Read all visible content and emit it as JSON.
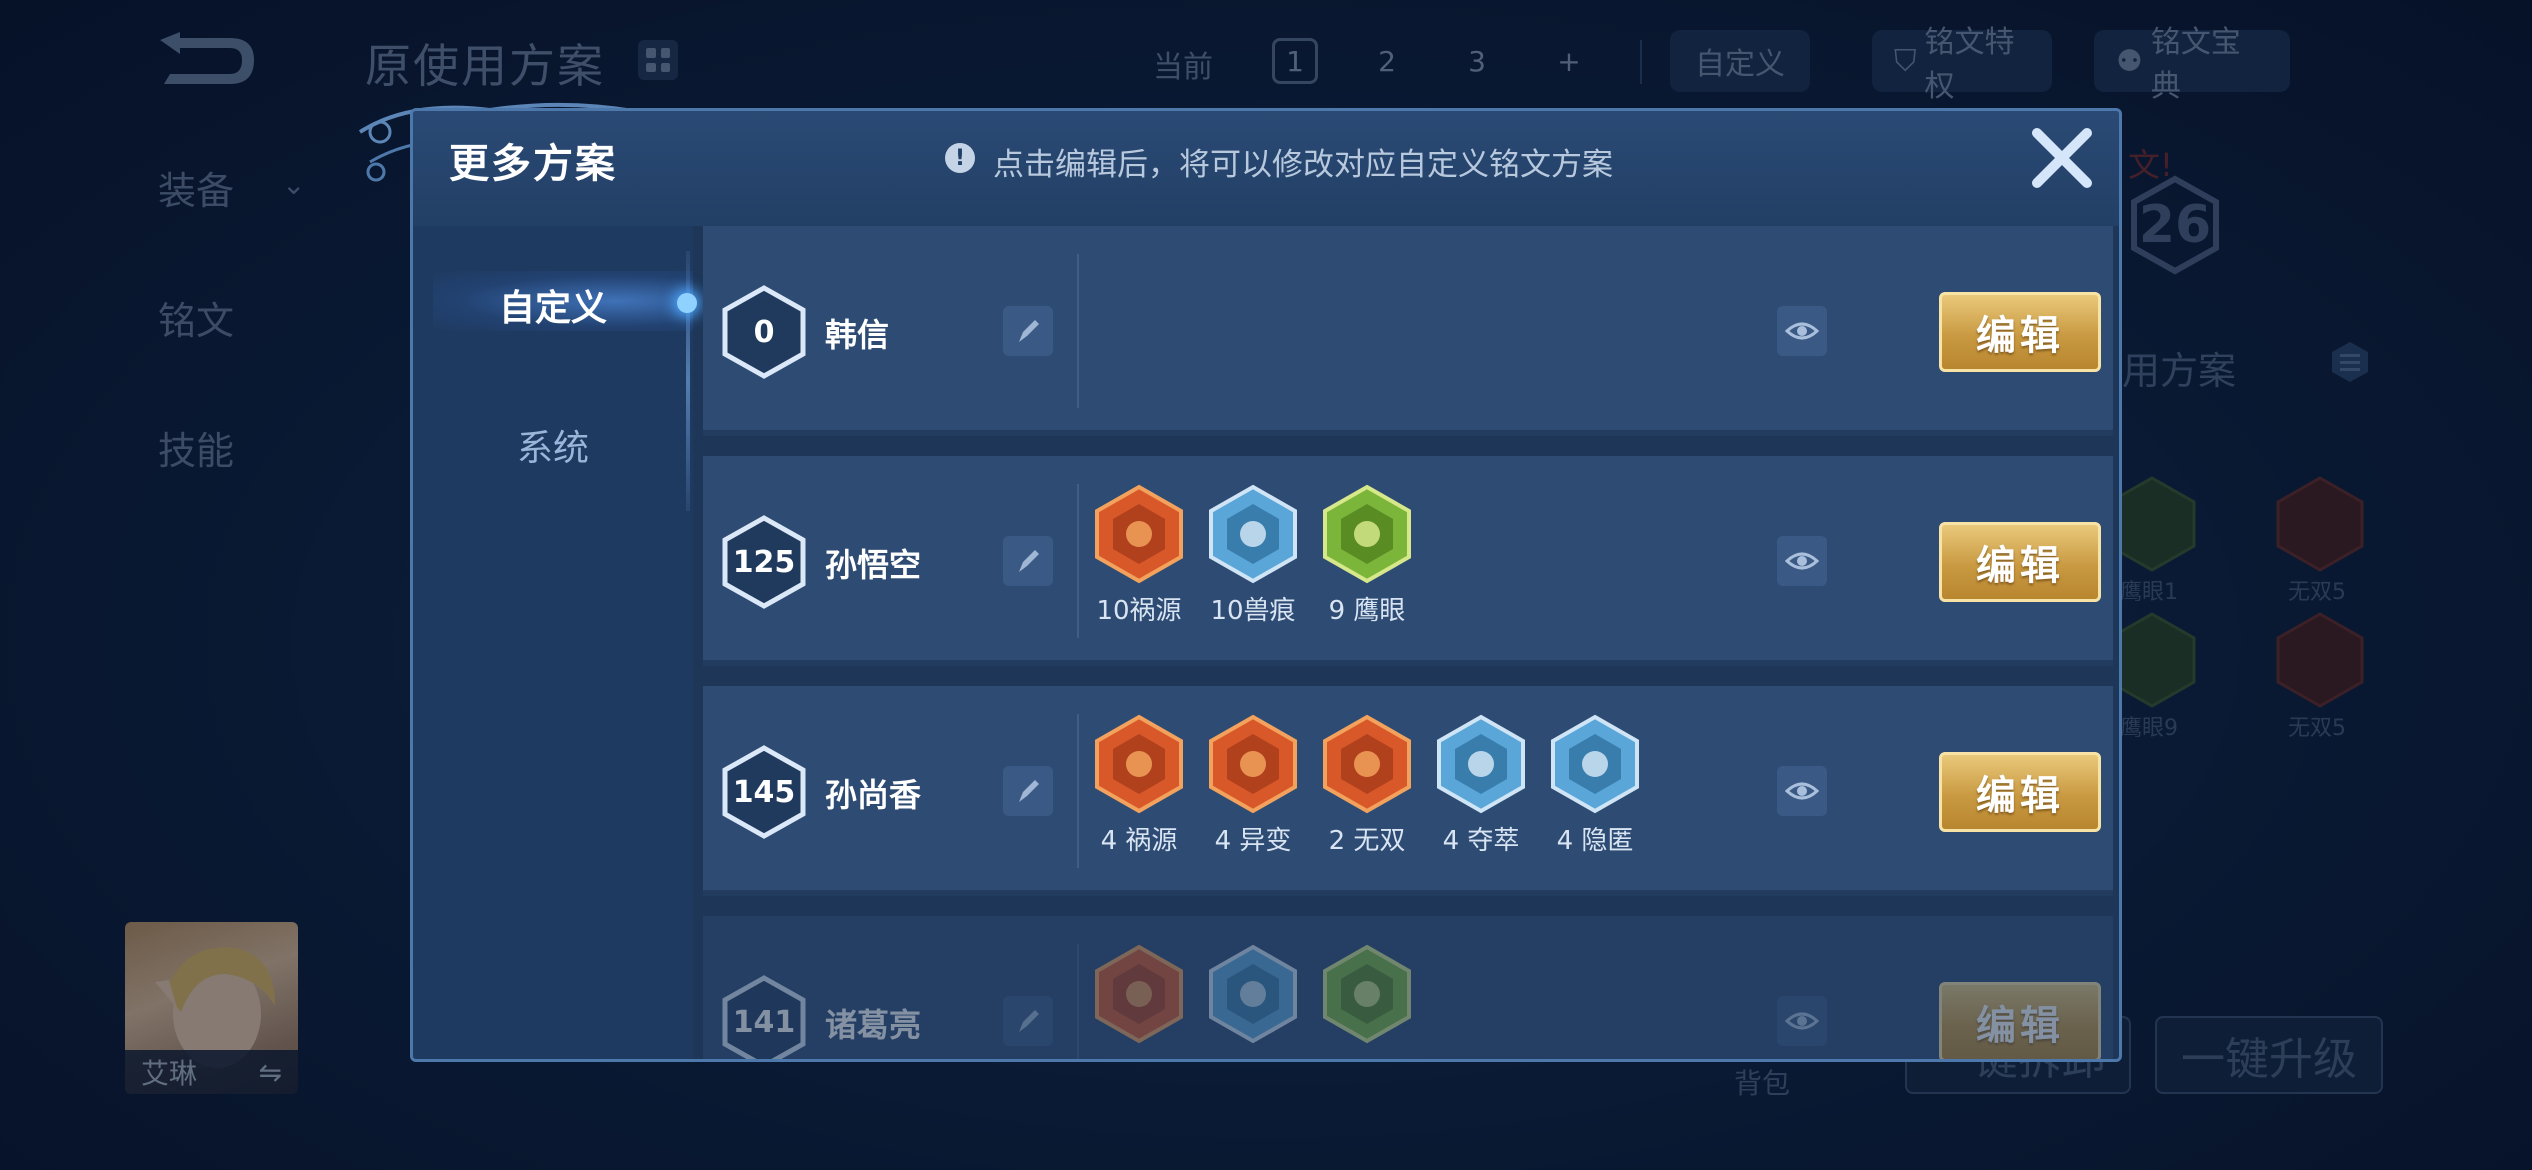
{
  "background": {
    "title": "原使用方案",
    "current_label": "当前",
    "plan_tabs": [
      "1",
      "2",
      "3",
      "+"
    ],
    "custom_label": "自定义",
    "privilege_label": "铭文特权",
    "codex_label": "铭文宝典",
    "side_nav": [
      "装备",
      "铭文",
      "技能"
    ],
    "hero_name": "艾琳",
    "hero_swap_glyph": "⇋",
    "level_badge": "26",
    "notice_fragment": "文!",
    "use_plan_fragment": "用方案",
    "bg_rune_labels": [
      "鹰眼1",
      "无双5",
      "鹰眼9",
      "无双5"
    ],
    "backpack_label": "背包",
    "dismantle_label": "一键拆卸",
    "upgrade_label": "一键升级"
  },
  "modal": {
    "title": "更多方案",
    "info_glyph": "!",
    "info_text": "点击编辑后，将可以修改对应自定义铭文方案",
    "close_icon": "close-icon",
    "nav": {
      "custom": "自定义",
      "system": "系统"
    },
    "edit_label": "编辑",
    "rows": [
      {
        "level": "0",
        "hero": "韩信",
        "runes": []
      },
      {
        "level": "125",
        "hero": "孙悟空",
        "runes": [
          {
            "label": "10祸源",
            "icon": "red-huoyuan"
          },
          {
            "label": "10兽痕",
            "icon": "blue-shouhen"
          },
          {
            "label": "9 鹰眼",
            "icon": "green-yingyan"
          }
        ]
      },
      {
        "level": "145",
        "hero": "孙尚香",
        "runes": [
          {
            "label": "4 祸源",
            "icon": "red-huoyuan"
          },
          {
            "label": "4 异变",
            "icon": "red-yibian"
          },
          {
            "label": "2 无双",
            "icon": "red-wushuang"
          },
          {
            "label": "4 夺萃",
            "icon": "blue-duocui"
          },
          {
            "label": "4 隐匿",
            "icon": "blue-yinni"
          }
        ]
      },
      {
        "level": "141",
        "hero": "诸葛亮",
        "runes": [
          {
            "label": "",
            "icon": "red-huoyuan"
          },
          {
            "label": "",
            "icon": "blue-shouhen"
          },
          {
            "label": "",
            "icon": "green-yingyan"
          }
        ]
      }
    ]
  },
  "colors": {
    "gold_button": "#c99a42",
    "red_rune": "#d9582a",
    "blue_rune": "#5aa6d8",
    "green_rune": "#7bb63a"
  }
}
